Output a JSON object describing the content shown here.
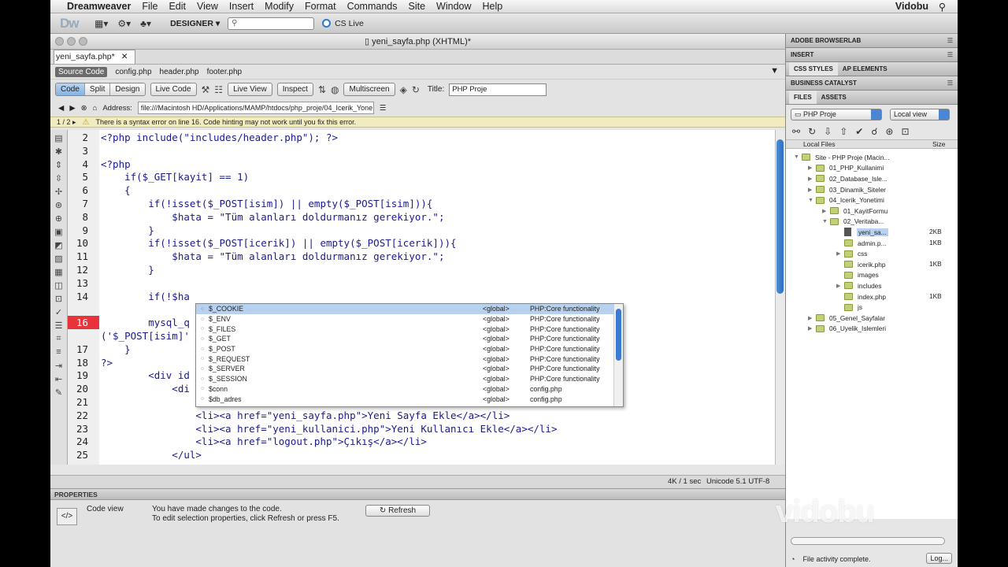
{
  "menubar": {
    "apple": "",
    "app": "Dreamweaver",
    "items": [
      "File",
      "Edit",
      "View",
      "Insert",
      "Modify",
      "Format",
      "Commands",
      "Site",
      "Window",
      "Help"
    ],
    "right": "Vidobu"
  },
  "appbar": {
    "logo": "Dw",
    "workspace": "DESIGNER ▾",
    "search_placeholder": "",
    "cs_live": "CS Live"
  },
  "document": {
    "title": "yeni_sayfa.php (XHTML)*",
    "tab": "yeni_sayfa.php*",
    "related_files": [
      "Source Code",
      "config.php",
      "header.php",
      "footer.php"
    ],
    "views": [
      "Code",
      "Split",
      "Design"
    ],
    "live_code": "Live Code",
    "live_view": "Live View",
    "inspect": "Inspect",
    "multiscreen": "Multiscreen",
    "title_label": "Title:",
    "title_value": "PHP Proje",
    "address_label": "Address:",
    "address_value": "file:///Macintosh HD/Applications/MAMP/htdocs/php_proje/04_Icerik_Yone",
    "warning_counter": "1 / 2 ▸",
    "warning": "There is a syntax error on line 16.  Code hinting may not work until you fix this error."
  },
  "code": {
    "lines": [
      {
        "n": "2",
        "text": "<?php include(\"includes/header.php\"); ?>"
      },
      {
        "n": "3",
        "text": ""
      },
      {
        "n": "4",
        "text": "<?php"
      },
      {
        "n": "5",
        "text": "    if($_GET[kayit] == 1)"
      },
      {
        "n": "6",
        "text": "    {"
      },
      {
        "n": "7",
        "text": "        if(!isset($_POST[isim]) || empty($_POST[isim])){"
      },
      {
        "n": "8",
        "text": "            $hata = \"Tüm alanları doldurmanız gerekiyor.\";"
      },
      {
        "n": "9",
        "text": "        }"
      },
      {
        "n": "10",
        "text": "        if(!isset($_POST[icerik]) || empty($_POST[icerik])){"
      },
      {
        "n": "11",
        "text": "            $hata = \"Tüm alanları doldurmanız gerekiyor.\";"
      },
      {
        "n": "12",
        "text": "        }"
      },
      {
        "n": "13",
        "text": ""
      },
      {
        "n": "14",
        "text": "        if(!$ha"
      },
      {
        "n": "",
        "text": ""
      },
      {
        "n": "16",
        "text": "        mysql_q"
      },
      {
        "n": "",
        "text": "('$_POST[isim]'"
      },
      {
        "n": "17",
        "text": "    }"
      },
      {
        "n": "18",
        "text": "?>"
      },
      {
        "n": "19",
        "text": "        <div id"
      },
      {
        "n": "20",
        "text": "            <di"
      },
      {
        "n": "21",
        "text": ""
      },
      {
        "n": "22",
        "text": "                <li><a href=\"yeni_sayfa.php\">Yeni Sayfa Ekle</a></li>"
      },
      {
        "n": "23",
        "text": "                <li><a href=\"yeni_kullanici.php\">Yeni Kullanıcı Ekle</a></li>"
      },
      {
        "n": "24",
        "text": "                <li><a href=\"logout.php\">Çıkış</a></li>"
      },
      {
        "n": "25",
        "text": "            </ul>"
      }
    ],
    "error_line": "16"
  },
  "autocomplete": [
    {
      "name": "$_COOKIE",
      "scope": "<global>",
      "source": "PHP:Core functionality"
    },
    {
      "name": "$_ENV",
      "scope": "<global>",
      "source": "PHP:Core functionality"
    },
    {
      "name": "$_FILES",
      "scope": "<global>",
      "source": "PHP:Core functionality"
    },
    {
      "name": "$_GET",
      "scope": "<global>",
      "source": "PHP:Core functionality"
    },
    {
      "name": "$_POST",
      "scope": "<global>",
      "source": "PHP:Core functionality"
    },
    {
      "name": "$_REQUEST",
      "scope": "<global>",
      "source": "PHP:Core functionality"
    },
    {
      "name": "$_SERVER",
      "scope": "<global>",
      "source": "PHP:Core functionality"
    },
    {
      "name": "$_SESSION",
      "scope": "<global>",
      "source": "PHP:Core functionality"
    },
    {
      "name": "$conn",
      "scope": "<global>",
      "source": "config.php"
    },
    {
      "name": "$db_adres",
      "scope": "<global>",
      "source": "config.php"
    }
  ],
  "statusbar": {
    "size": "4K / 1 sec",
    "encoding": "Unicode 5.1 UTF-8"
  },
  "properties": {
    "header": "PROPERTIES",
    "view": "Code view",
    "msg1": "You have made changes to the code.",
    "msg2": "To edit selection properties, click Refresh or press F5.",
    "refresh": "Refresh"
  },
  "panels": {
    "browserlab": "ADOBE BROWSERLAB",
    "insert": "INSERT",
    "css_styles": "CSS STYLES",
    "ap_elements": "AP ELEMENTS",
    "business_catalyst": "BUSINESS CATALYST",
    "files_tab": "FILES",
    "assets_tab": "ASSETS",
    "site_select": "PHP Proje",
    "view_select": "Local view",
    "col_local": "Local Files",
    "col_size": "Size",
    "status": "File activity complete.",
    "log": "Log..."
  },
  "files": [
    {
      "name": "Site - PHP Proje (Macin...",
      "type": "folder",
      "depth": 0,
      "open": true,
      "size": ""
    },
    {
      "name": "01_PHP_Kullanimi",
      "type": "folder",
      "depth": 1,
      "open": false,
      "size": ""
    },
    {
      "name": "02_Database_Isle...",
      "type": "folder",
      "depth": 1,
      "open": false,
      "size": ""
    },
    {
      "name": "03_Dinamik_Siteler",
      "type": "folder",
      "depth": 1,
      "open": false,
      "size": ""
    },
    {
      "name": "04_Icerik_Yonetimi",
      "type": "folder",
      "depth": 1,
      "open": true,
      "size": ""
    },
    {
      "name": "01_KayitFormu",
      "type": "folder",
      "depth": 2,
      "open": false,
      "size": ""
    },
    {
      "name": "02_Veritaba...",
      "type": "folder",
      "depth": 2,
      "open": true,
      "size": ""
    },
    {
      "name": "yeni_sa...",
      "type": "file",
      "depth": 3,
      "open": false,
      "size": "2KB",
      "selected": true
    },
    {
      "name": "admin.p...",
      "type": "folder",
      "depth": 3,
      "open": false,
      "size": "1KB"
    },
    {
      "name": "css",
      "type": "folder",
      "depth": 3,
      "open": false,
      "size": ""
    },
    {
      "name": "icerik.php",
      "type": "folder",
      "depth": 3,
      "open": false,
      "size": "1KB"
    },
    {
      "name": "images",
      "type": "folder",
      "depth": 3,
      "open": false,
      "size": ""
    },
    {
      "name": "includes",
      "type": "folder",
      "depth": 3,
      "open": false,
      "size": ""
    },
    {
      "name": "index.php",
      "type": "folder",
      "depth": 3,
      "open": false,
      "size": "1KB"
    },
    {
      "name": "js",
      "type": "folder",
      "depth": 3,
      "open": false,
      "size": ""
    },
    {
      "name": "05_Genel_Sayfalar",
      "type": "folder",
      "depth": 1,
      "open": false,
      "size": ""
    },
    {
      "name": "06_Uyelik_Islemleri",
      "type": "folder",
      "depth": 1,
      "open": false,
      "size": ""
    }
  ],
  "watermark": "vidobu"
}
